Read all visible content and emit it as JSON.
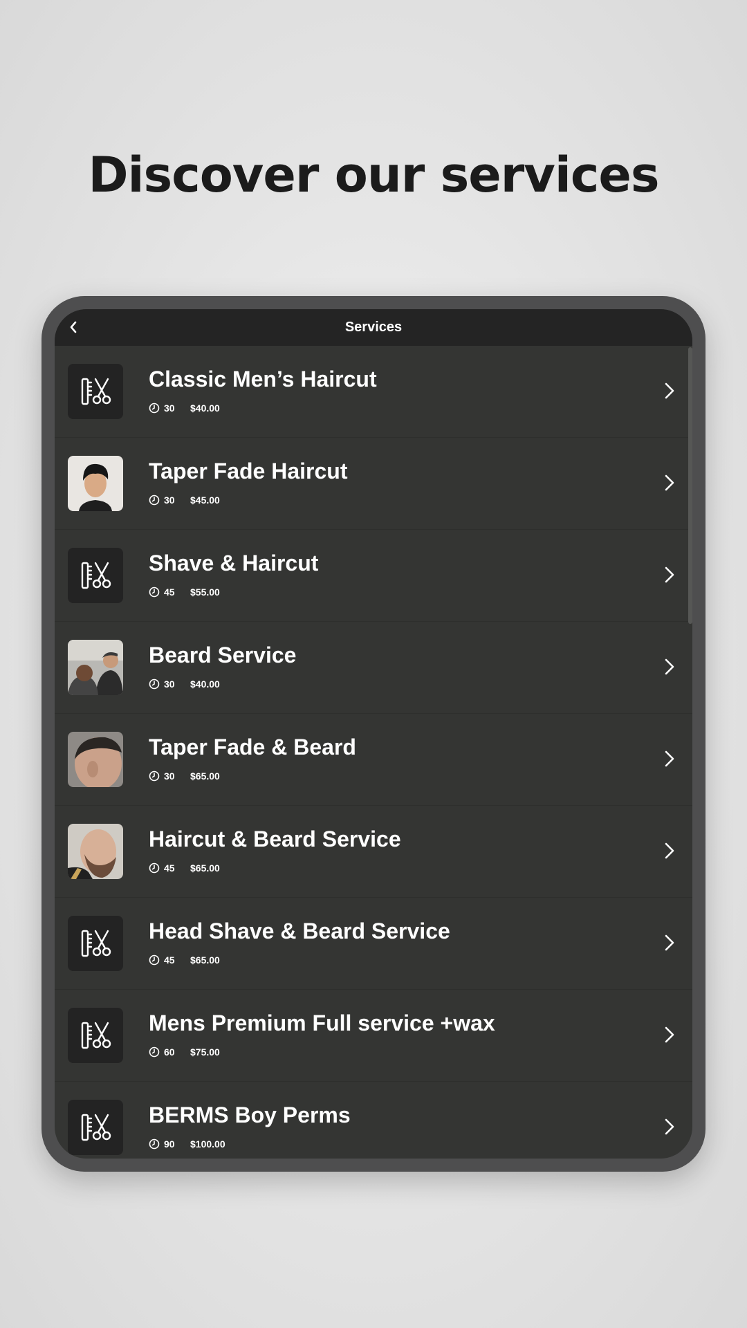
{
  "headline": "Discover our services",
  "app": {
    "nav_title": "Services",
    "back_icon": "chevron-left-icon"
  },
  "services": [
    {
      "name": "Classic Men’s Haircut",
      "duration": "30",
      "price": "$40.00",
      "thumbnail": "comb-scissors-icon"
    },
    {
      "name": "Taper Fade Haircut",
      "duration": "30",
      "price": "$45.00",
      "thumbnail": "photo"
    },
    {
      "name": "Shave & Haircut",
      "duration": "45",
      "price": "$55.00",
      "thumbnail": "comb-scissors-icon"
    },
    {
      "name": "Beard Service",
      "duration": "30",
      "price": "$40.00",
      "thumbnail": "photo"
    },
    {
      "name": "Taper Fade & Beard",
      "duration": "30",
      "price": "$65.00",
      "thumbnail": "photo"
    },
    {
      "name": "Haircut & Beard Service",
      "duration": "45",
      "price": "$65.00",
      "thumbnail": "photo"
    },
    {
      "name": "Head Shave & Beard Service",
      "duration": "45",
      "price": "$65.00",
      "thumbnail": "comb-scissors-icon"
    },
    {
      "name": "Mens Premium Full service +wax",
      "duration": "60",
      "price": "$75.00",
      "thumbnail": "comb-scissors-icon"
    },
    {
      "name": "BERMS Boy Perms",
      "duration": "90",
      "price": "$100.00",
      "thumbnail": "comb-scissors-icon"
    }
  ],
  "colors": {
    "screen_bg": "#343533",
    "navbar_bg": "#242424",
    "device_frame": "#4e4e4f",
    "text": "#ffffff"
  }
}
